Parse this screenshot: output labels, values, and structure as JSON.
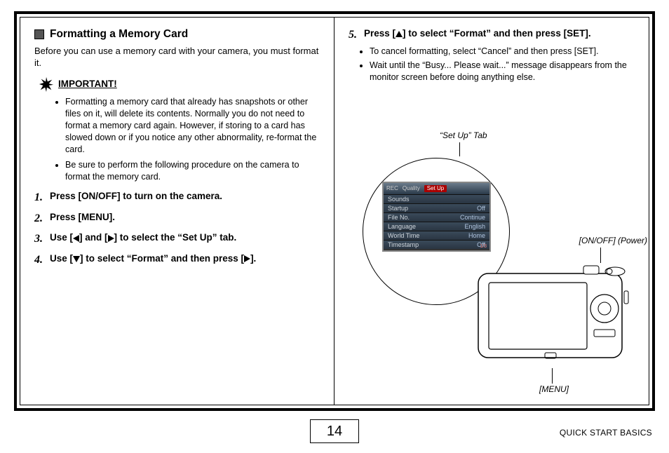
{
  "left": {
    "section_title": "Formatting a Memory Card",
    "intro": "Before you can use a memory card with your camera, you must format it.",
    "important_label": "IMPORTANT!",
    "important_bullets": [
      "Formatting a memory card that already has snapshots or other files on it, will delete its contents. Normally you do not need to format a memory card again. However, if storing to a card has slowed down or if you notice any other abnormality, re-format the card.",
      "Be sure to perform the following procedure on the camera to format the memory card."
    ],
    "steps": {
      "s1": "Press [ON/OFF] to turn on the camera.",
      "s2": "Press [MENU].",
      "s3_a": "Use [",
      "s3_b": "] and [",
      "s3_c": "] to select the “Set Up” tab.",
      "s4_a": "Use [",
      "s4_b": "] to select “Format” and then press [",
      "s4_c": "]."
    }
  },
  "right": {
    "step5_a": "Press [",
    "step5_b": "] to select “Format” and then press [SET].",
    "sub_bullets": [
      "To cancel formatting, select “Cancel” and then press [SET].",
      "Wait until the “Busy... Please wait...” message disappears from the monitor screen before doing anything else."
    ],
    "setup_tab_label": "“Set Up” Tab",
    "onoff_label": "[ON/OFF] (Power)",
    "menu_label": "[MENU]",
    "screen": {
      "tabs": {
        "rec": "REC",
        "quality": "Quality",
        "setup": "Set Up"
      },
      "rows": [
        {
          "k": "Sounds",
          "v": ""
        },
        {
          "k": "Startup",
          "v": "Off"
        },
        {
          "k": "File No.",
          "v": "Continue"
        },
        {
          "k": "Language",
          "v": "English"
        },
        {
          "k": "World Time",
          "v": "Home"
        },
        {
          "k": "Timestamp",
          "v": "Off"
        }
      ],
      "page": "1/3"
    }
  },
  "footer": {
    "page_num": "14",
    "section": "QUICK START BASICS"
  }
}
